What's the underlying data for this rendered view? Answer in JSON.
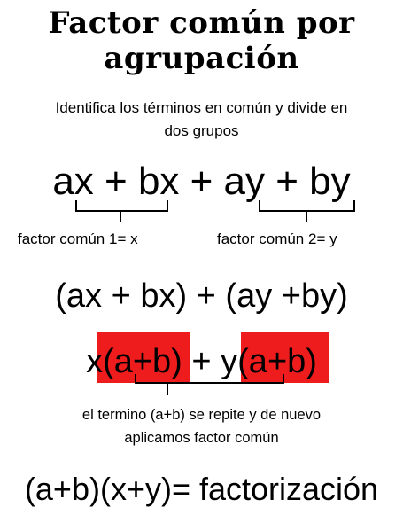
{
  "title": {
    "line1": "Factor común por",
    "line2": "agrupación"
  },
  "intro": {
    "line1": "Identifica los términos en común y divide en",
    "line2": "dos grupos"
  },
  "expression1": "ax + bx + ay + by",
  "factor_labels": {
    "left": "factor común 1= x",
    "right": "factor común 2= y"
  },
  "expression2": "(ax + bx) + (ay +by)",
  "expression3": {
    "x": "x",
    "group1": "(a+b)",
    "plus": " + ",
    "y": "y",
    "group2": "(a+b)"
  },
  "note": {
    "line1": "el termino (a+b) se repite y de nuevo",
    "line2": "aplicamos factor común"
  },
  "result": "(a+b)(x+y)= factorización",
  "colors": {
    "highlight": "#ee1c1c"
  }
}
